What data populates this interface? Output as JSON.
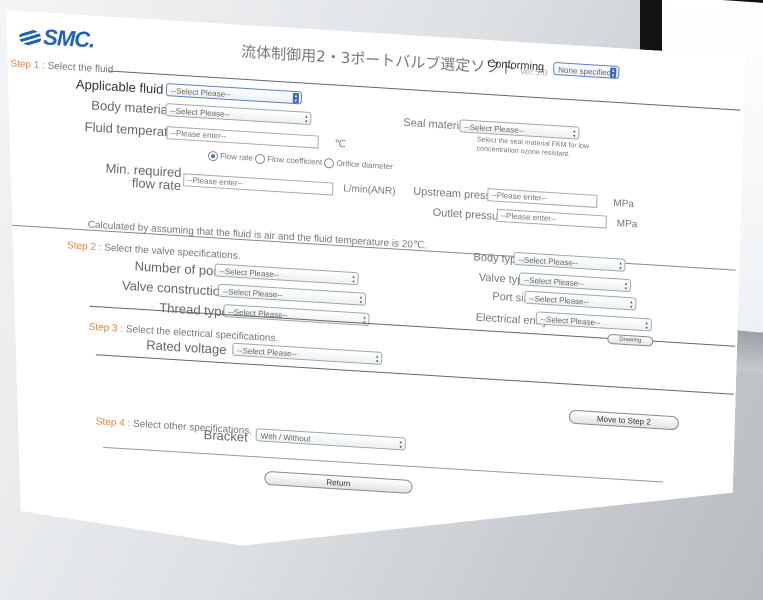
{
  "header": {
    "logo": "SMC.",
    "title": "流体制御用2・3ポートバルブ選定ソフト",
    "version": "Ver.5.0",
    "conforming_label": "Conforming",
    "conforming_value": "None specified"
  },
  "step1": {
    "step": "Step 1 :",
    "title": "Select the fluid",
    "applicable_fluid": {
      "label": "Applicable fluid",
      "value": "--Select Please--"
    },
    "body_material": {
      "label": "Body material",
      "value": "--Select Please--"
    },
    "seal_material": {
      "label": "Seal material",
      "value": "--Select Please--"
    },
    "seal_note": "Select the seal material FKM for low concentration ozone resistant.",
    "fluid_temperature": {
      "label": "Fluid temperature",
      "placeholder": "--Please enter--",
      "unit": "℃"
    },
    "radio_options": [
      "Flow rate",
      "Flow coefficient",
      "Orifice diameter"
    ],
    "min_flow": {
      "label": "Min. required flow rate",
      "placeholder": "--Please enter--",
      "unit": "L/min(ANR)"
    },
    "upstream_pressure": {
      "label": "Upstream pressure",
      "placeholder": "--Please enter--",
      "unit": "MPa"
    },
    "outlet_pressure": {
      "label": "Outlet pressure",
      "placeholder": "--Please enter--",
      "unit": "MPa"
    },
    "note": "Calculated by assuming that the fluid is air and the fluid temperature is 20℃."
  },
  "step2": {
    "step": "Step 2 :",
    "title": "Select the valve specifications.",
    "number_of_ports": {
      "label": "Number of ports",
      "value": "--Select Please--"
    },
    "valve_construction": {
      "label": "Valve construction",
      "value": "--Select Please--"
    },
    "thread_type": {
      "label": "Thread type",
      "value": "--Select Please--"
    },
    "body_type": {
      "label": "Body type",
      "value": "--Select Please--"
    },
    "valve_type": {
      "label": "Valve type",
      "value": "--Select Please--"
    },
    "port_size": {
      "label": "Port size",
      "value": "--Select Please--"
    }
  },
  "step3": {
    "step": "Step 3 :",
    "title": "Select the electrical specifications.",
    "rated_voltage": {
      "label": "Rated voltage",
      "value": "--Select Please--"
    },
    "electrical_entry": {
      "label": "Electrical entry",
      "value": "--Select Please--"
    },
    "drawing_button": "Drawing"
  },
  "step4": {
    "step": "Step 4 :",
    "title": "Select other specifications.",
    "bracket": {
      "label": "Bracket",
      "value": "With / Without"
    },
    "move_button": "Move to Step 2"
  },
  "return_button": "Return"
}
